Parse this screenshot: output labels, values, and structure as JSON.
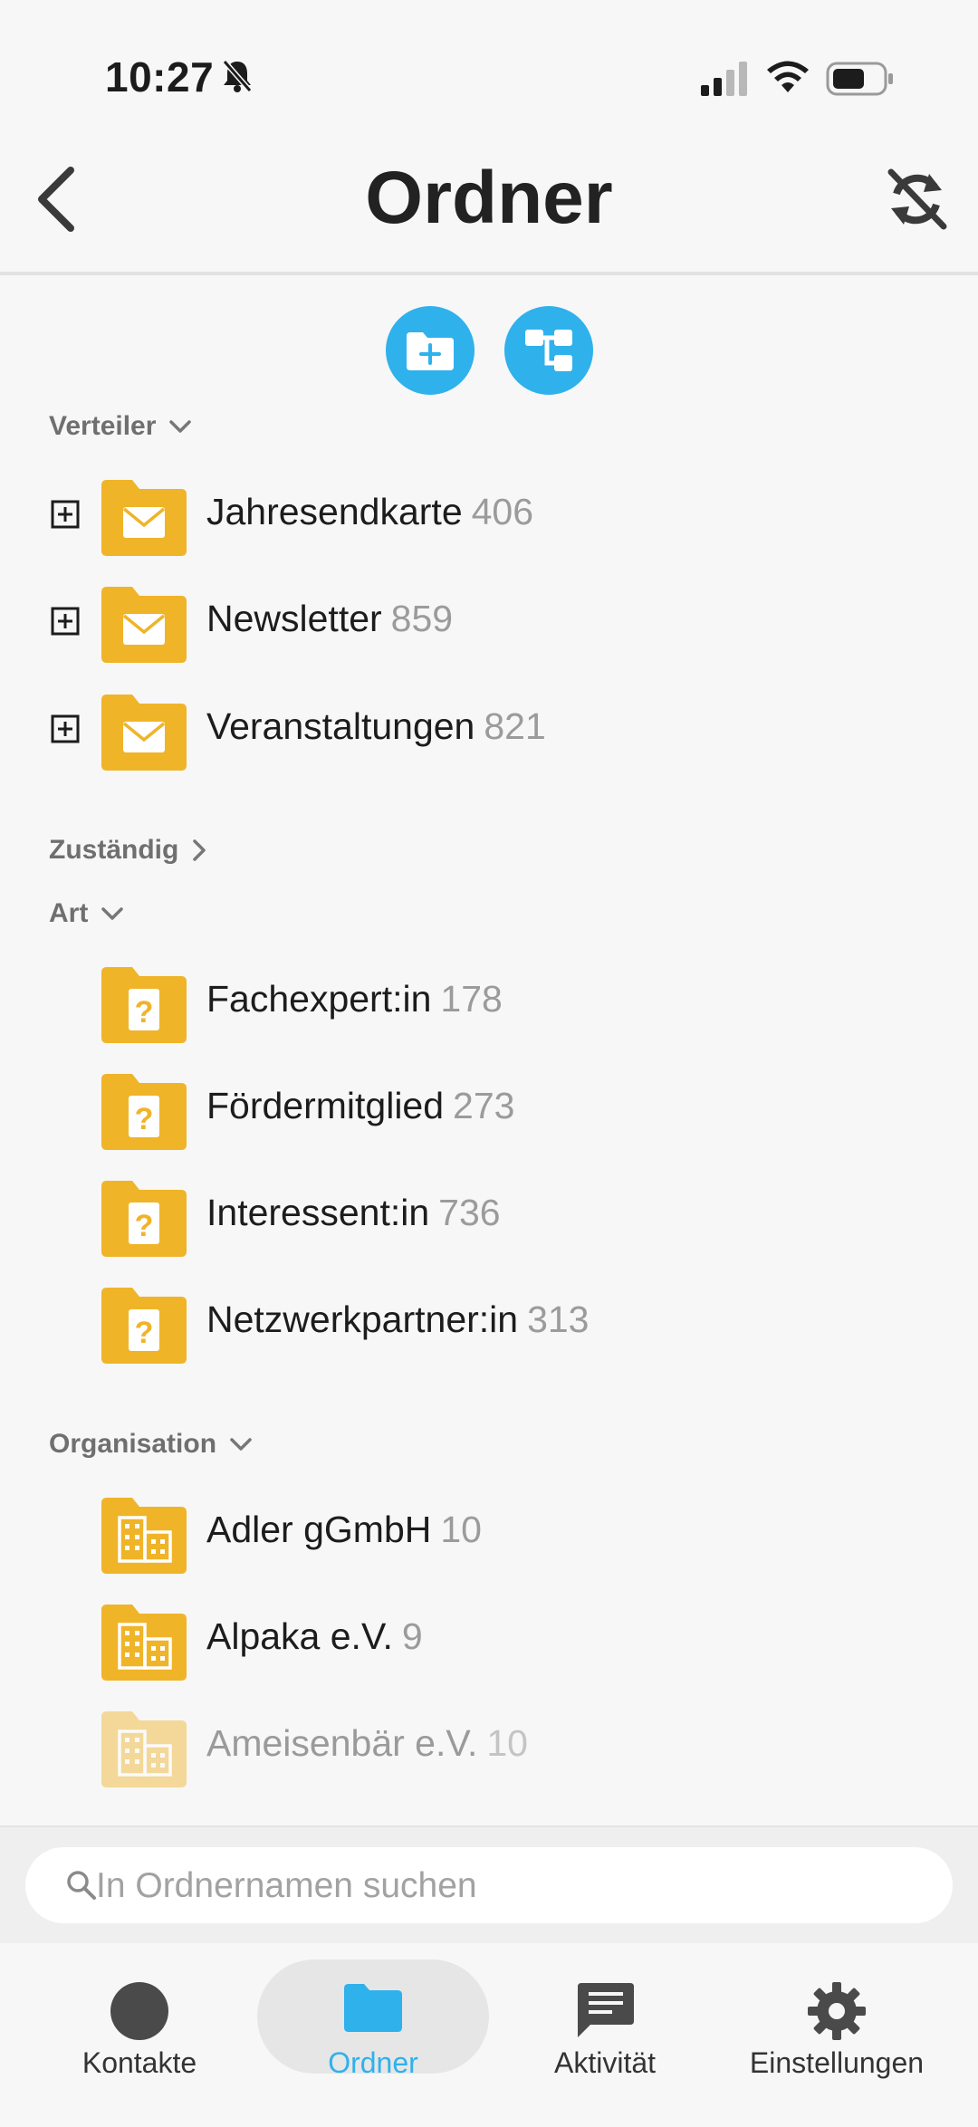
{
  "status_bar": {
    "time": "10:27"
  },
  "header": {
    "title": "Ordner"
  },
  "sections": {
    "verteiler": {
      "title": "Verteiler",
      "items": [
        {
          "name": "Jahresendkarte",
          "count": "406"
        },
        {
          "name": "Newsletter",
          "count": "859"
        },
        {
          "name": "Veranstaltungen",
          "count": "821"
        }
      ]
    },
    "zustaendig": {
      "title": "Zuständig"
    },
    "art": {
      "title": "Art",
      "items": [
        {
          "name": "Fachexpert:in",
          "count": "178"
        },
        {
          "name": "Fördermitglied",
          "count": "273"
        },
        {
          "name": "Interessent:in",
          "count": "736"
        },
        {
          "name": "Netzwerkpartner:in",
          "count": "313"
        }
      ]
    },
    "organisation": {
      "title": "Organisation",
      "items": [
        {
          "name": "Adler gGmbH",
          "count": "10"
        },
        {
          "name": "Alpaka e.V.",
          "count": "9"
        },
        {
          "name": "Ameisenbär e.V.",
          "count": "10"
        }
      ]
    }
  },
  "search": {
    "placeholder": "In Ordnernamen suchen",
    "value": ""
  },
  "bottom_nav": {
    "kontakte": "Kontakte",
    "ordner": "Ordner",
    "aktivitaet": "Aktivität",
    "einstellungen": "Einstellungen"
  },
  "colors": {
    "accent": "#2fb1ec",
    "folder": "#f0b429",
    "muted": "#9b9b9b"
  },
  "icons": {
    "distribution_folder": "mail-folder-icon",
    "type_folder": "question-folder-icon",
    "organisation_folder": "building-folder-icon"
  }
}
